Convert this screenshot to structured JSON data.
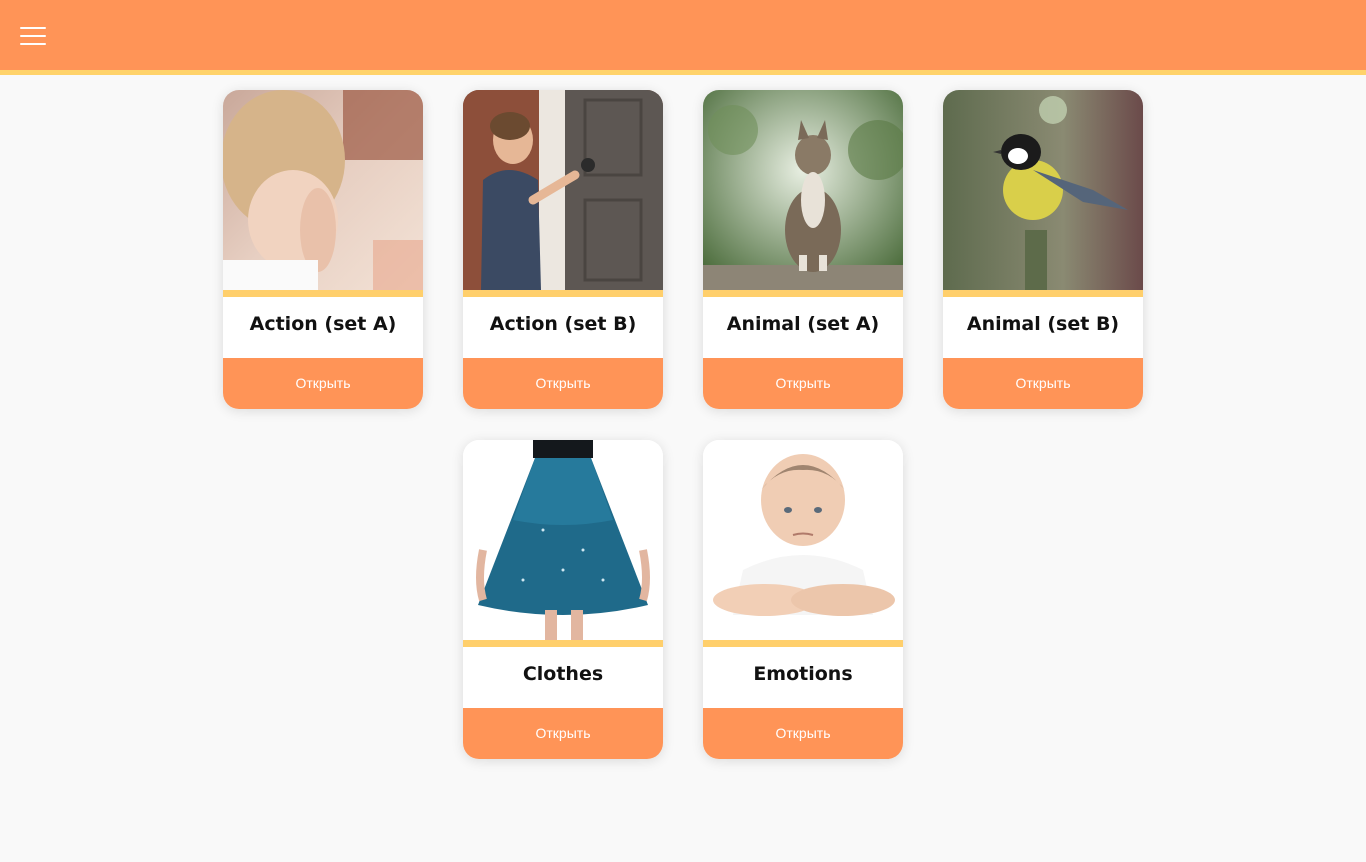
{
  "header": {
    "menu_icon": "hamburger-menu-icon",
    "colors": {
      "bar": "#ff9457",
      "accent": "#ffd36b"
    }
  },
  "cards": [
    {
      "title": "Action (set A)",
      "button": "Открыть",
      "image": "curly-haired child covering face"
    },
    {
      "title": "Action (set B)",
      "button": "Открыть",
      "image": "boy opening door"
    },
    {
      "title": "Animal (set A)",
      "button": "Открыть",
      "image": "tabby cat sitting"
    },
    {
      "title": "Animal (set B)",
      "button": "Открыть",
      "image": "great tit bird on post"
    },
    {
      "title": "Clothes",
      "button": "Открыть",
      "image": "blue skirt"
    },
    {
      "title": "Emotions",
      "button": "Открыть",
      "image": "sad boy resting on arms"
    }
  ]
}
